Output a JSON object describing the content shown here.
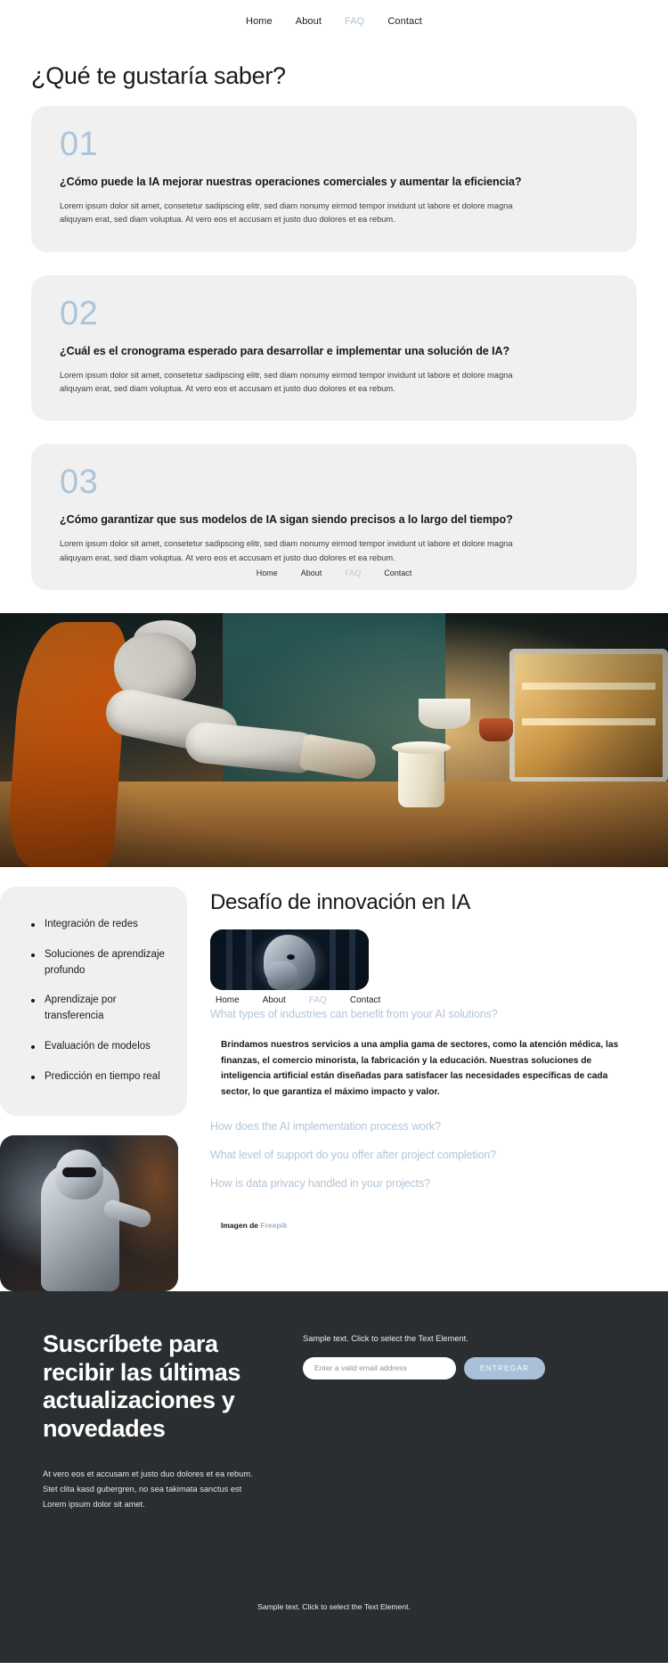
{
  "nav": {
    "items": [
      {
        "label": "Home",
        "active": false
      },
      {
        "label": "About",
        "active": false
      },
      {
        "label": "FAQ",
        "active": true
      },
      {
        "label": "Contact",
        "active": false
      }
    ]
  },
  "page_title": "¿Qué te gustaría saber?",
  "faq": {
    "cards": [
      {
        "number": "01",
        "question": "¿Cómo puede la IA mejorar nuestras operaciones comerciales y aumentar la eficiencia?",
        "answer": "Lorem ipsum dolor sit amet, consetetur sadipscing elitr, sed diam nonumy eirmod tempor invidunt ut labore et dolore magna aliquyam erat, sed diam voluptua. At vero eos et accusam et justo duo dolores et ea rebum."
      },
      {
        "number": "02",
        "question": "¿Cuál es el cronograma esperado para desarrollar e implementar una solución de IA?",
        "answer": "Lorem ipsum dolor sit amet, consetetur sadipscing elitr, sed diam nonumy eirmod tempor invidunt ut labore et dolore magna aliquyam erat, sed diam voluptua. At vero eos et accusam et justo duo dolores et ea rebum."
      },
      {
        "number": "03",
        "question": "¿Cómo garantizar que sus modelos de IA sigan siendo precisos a lo largo del tiempo?",
        "answer": "Lorem ipsum dolor sit amet, consetetur sadipscing elitr, sed diam nonumy eirmod tempor invidunt ut labore et dolore magna aliquyam erat, sed diam voluptua. At vero eos et accusam et justo duo dolores et ea rebum."
      }
    ]
  },
  "features": {
    "items": [
      {
        "label": "Integración de redes"
      },
      {
        "label": "Soluciones de aprendizaje profundo"
      },
      {
        "label": "Aprendizaje por transferencia"
      },
      {
        "label": "Evaluación de modelos"
      },
      {
        "label": "Predicción en tiempo real"
      }
    ]
  },
  "challenge": {
    "title": "Desafío de innovación en IA",
    "accordion": [
      {
        "question": "What types of industries can benefit from your AI solutions?",
        "open": true,
        "answer": "Brindamos nuestros servicios a una amplia gama de sectores, como la atención médica, las finanzas, el comercio minorista, la fabricación y la educación. Nuestras soluciones de inteligencia artificial están diseñadas para satisfacer las necesidades específicas de cada sector, lo que garantiza el máximo impacto y valor."
      },
      {
        "question": "How does the AI implementation process work?",
        "open": false,
        "answer": ""
      },
      {
        "question": "What level of support do you offer after project completion?",
        "open": false,
        "answer": ""
      },
      {
        "question": "How is data privacy handled in your projects?",
        "open": false,
        "answer": ""
      }
    ],
    "credit_prefix": "Imagen de ",
    "credit_link": "Freepik"
  },
  "newsletter": {
    "title": "Suscríbete para recibir las últimas actualizaciones y novedades",
    "subtitle": "At vero eos et accusam et justo duo dolores et ea rebum.\nStet clita kasd gubergren, no sea takimata sanctus est\nLorem ipsum dolor sit amet.",
    "sample_text": "Sample text. Click to select the Text Element.",
    "email_placeholder": "Enter a valid email address",
    "email_value": "",
    "submit_label": "ENTREGAR"
  },
  "footer": {
    "note": "Sample text. Click to select the Text Element."
  },
  "colors": {
    "accent": "#adc3d8",
    "card_bg": "#f0f0f0",
    "dark_bg": "#2b2e30",
    "button": "#a9c0d8"
  }
}
